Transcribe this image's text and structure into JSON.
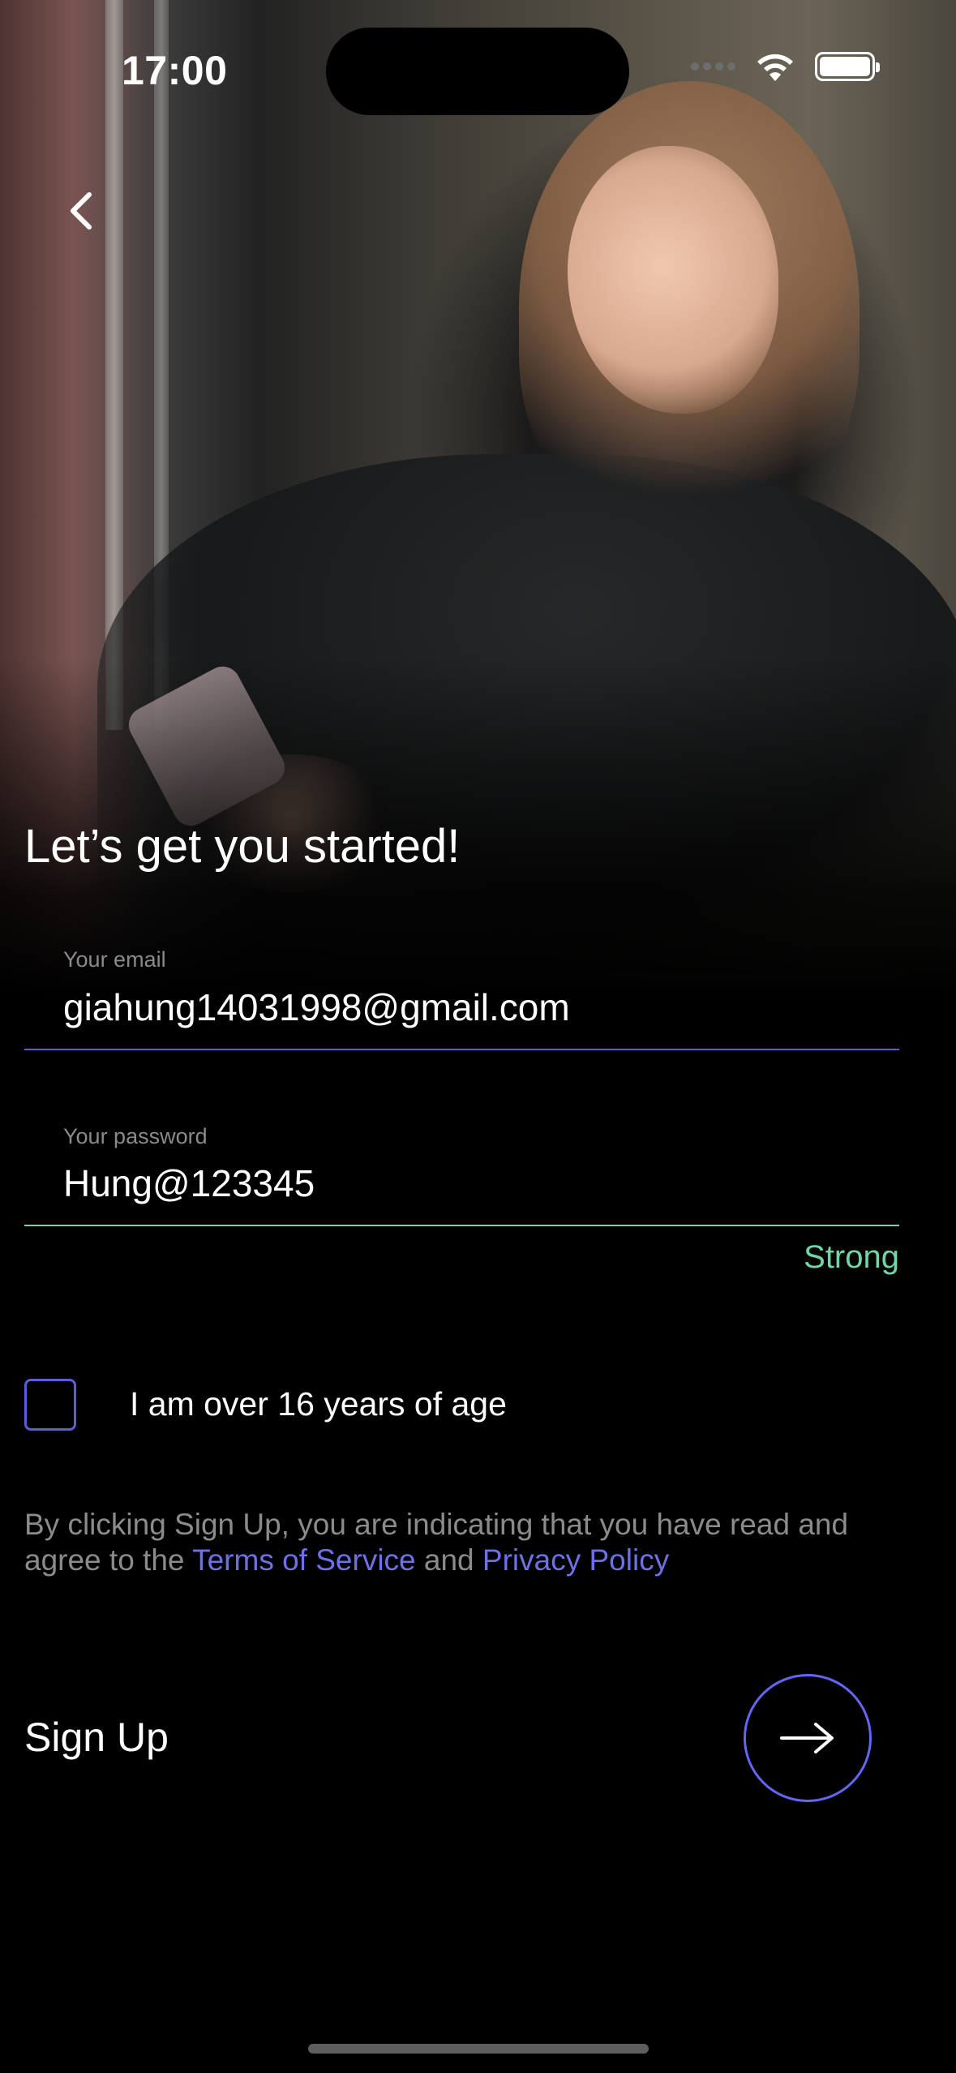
{
  "status_bar": {
    "time": "17:00"
  },
  "header": {
    "back_icon": "chevron-left-icon"
  },
  "title": "Let’s get you started!",
  "form": {
    "email": {
      "label": "Your email",
      "value": "giahung14031998@gmail.com"
    },
    "password": {
      "label": "Your password",
      "value": "Hung@123345",
      "strength": "Strong"
    },
    "age_checkbox": {
      "label": "I am over 16 years of age",
      "checked": false
    }
  },
  "legal": {
    "prefix": "By clicking Sign Up, you are indicating that you have read and agree to the ",
    "terms_link": "Terms of Service",
    "conjunction": " and ",
    "privacy_link": "Privacy Policy"
  },
  "signup": {
    "label": "Sign Up",
    "button_icon": "arrow-right-icon"
  },
  "colors": {
    "accent": "#6366f1",
    "success": "#6fd7a6",
    "link": "#6e71e6",
    "background": "#000000"
  }
}
